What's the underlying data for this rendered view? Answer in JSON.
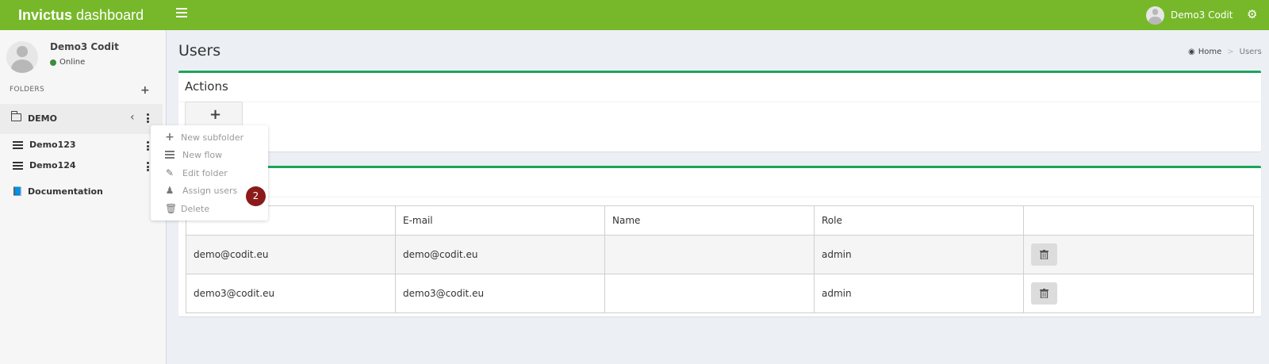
{
  "app": {
    "title_bold": "Invictus",
    "title_rest": "dashboard"
  },
  "header": {
    "user_name": "Demo3 Codit",
    "icons": {
      "menu": "hamburger-icon",
      "settings": "gears-icon"
    }
  },
  "sidebar": {
    "user_name": "Demo3 Codit",
    "status": "Online",
    "folders_label": "FOLDERS",
    "folder": {
      "label": "DEMO"
    },
    "flows": [
      {
        "label": "Demo123"
      },
      {
        "label": "Demo124"
      }
    ],
    "documentation": "Documentation"
  },
  "context_menu": {
    "items": [
      {
        "label": "New subfolder",
        "icon": "plus-icon"
      },
      {
        "label": "New flow",
        "icon": "list-icon"
      },
      {
        "label": "Edit folder",
        "icon": "edit-icon"
      },
      {
        "label": "Assign users",
        "icon": "users-icon"
      },
      {
        "label": "Delete",
        "icon": "trash-icon"
      }
    ],
    "badge": "2"
  },
  "page": {
    "title": "Users",
    "breadcrumb": {
      "home": "Home",
      "current": "Users"
    }
  },
  "actions_box": {
    "title": "Actions",
    "add_label": "+"
  },
  "users_table": {
    "headers": [
      "",
      "E-mail",
      "Name",
      "Role",
      ""
    ],
    "rows": [
      {
        "username": "demo@codit.eu",
        "email": "demo@codit.eu",
        "name": "",
        "role": "admin"
      },
      {
        "username": "demo3@codit.eu",
        "email": "demo3@codit.eu",
        "name": "",
        "role": "admin"
      }
    ]
  },
  "colors": {
    "header": "#76b82a",
    "box_border": "#1aa55a",
    "badge": "#8b1a1a"
  }
}
